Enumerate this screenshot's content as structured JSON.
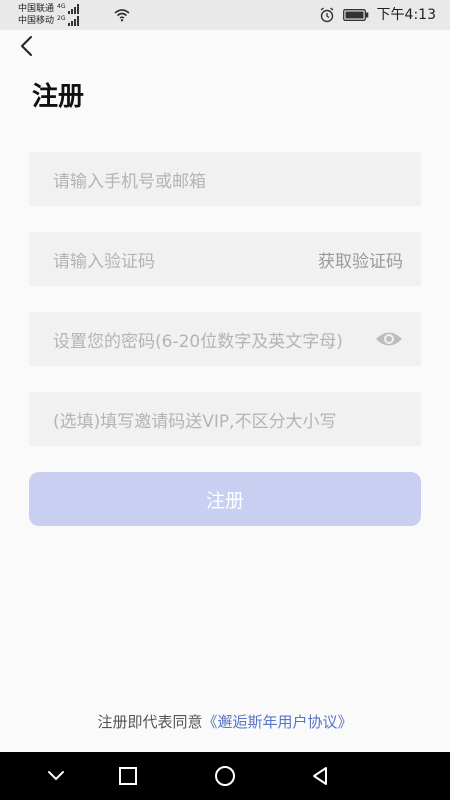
{
  "status_bar": {
    "carrier_1": "中国联通",
    "carrier_1_net": "4G",
    "carrier_2": "中国移动",
    "carrier_2_net": "2G",
    "time": "下午4:13",
    "icons": [
      "signal-icon",
      "wifi-icon",
      "alarm-icon",
      "battery-icon"
    ]
  },
  "page": {
    "title": "注册"
  },
  "form": {
    "account_placeholder": "请输入手机号或邮箱",
    "code_placeholder": "请输入验证码",
    "get_code_label": "获取验证码",
    "password_placeholder": "设置您的密码(6-20位数字及英文字母)",
    "invite_placeholder": "(选填)填写邀请码送VIP,不区分大小写",
    "submit_label": "注册"
  },
  "footer": {
    "agreement_prefix": "注册即代表同意",
    "agreement_link": "《邂逅斯年用户协议》"
  },
  "colors": {
    "button_disabled": "#c9cff0",
    "link": "#5a74c6",
    "field_bg": "#f1f1f1"
  }
}
